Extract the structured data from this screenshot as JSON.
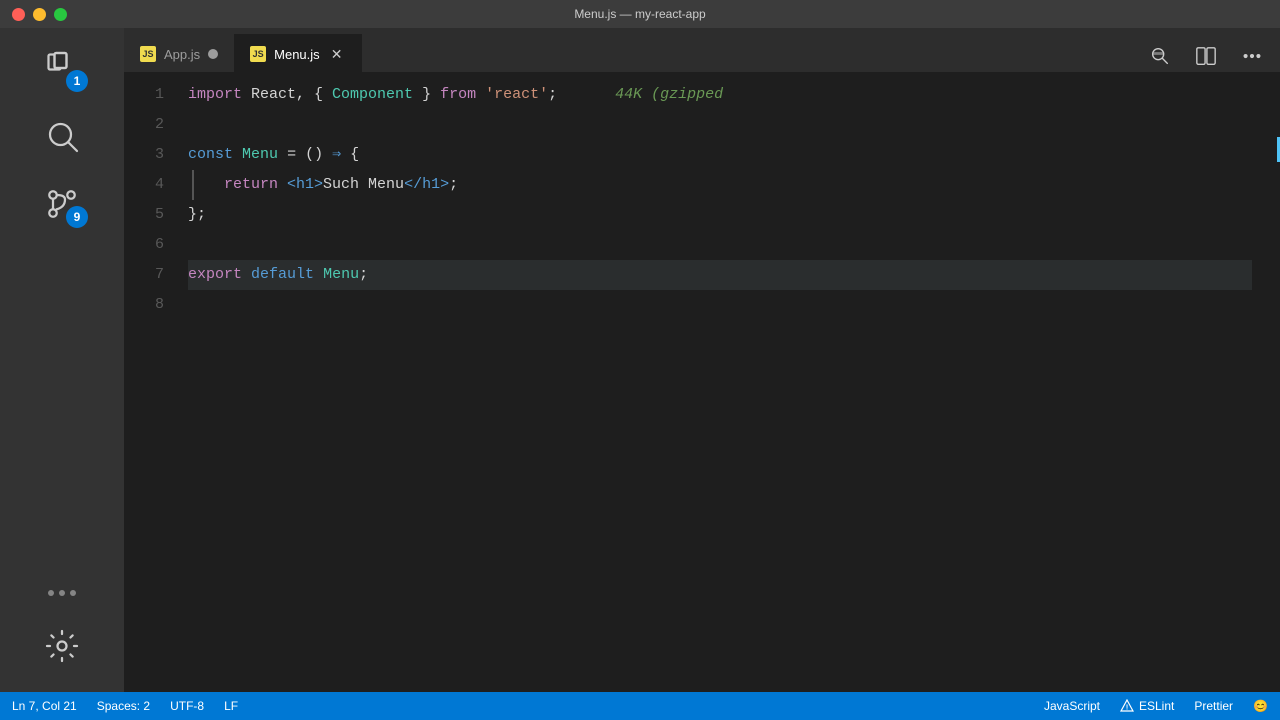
{
  "titleBar": {
    "title": "Menu.js — my-react-app"
  },
  "tabs": [
    {
      "id": "app-js",
      "label": "App.js",
      "active": false,
      "modified": true
    },
    {
      "id": "menu-js",
      "label": "Menu.js",
      "active": true,
      "modified": false
    }
  ],
  "toolbar": {
    "search_icon_label": "search",
    "split_icon_label": "split-editor",
    "more_icon_label": "more-actions"
  },
  "code": {
    "lines": [
      {
        "num": 1,
        "tokens": [
          {
            "type": "kw-import",
            "text": "import"
          },
          {
            "type": "plain",
            "text": " React, "
          },
          {
            "type": "punct",
            "text": "{ "
          },
          {
            "type": "comp",
            "text": "Component"
          },
          {
            "type": "punct",
            "text": " }"
          },
          {
            "type": "plain",
            "text": " "
          },
          {
            "type": "kw-from",
            "text": "from"
          },
          {
            "type": "plain",
            "text": " "
          },
          {
            "type": "str",
            "text": "'react'"
          },
          {
            "type": "plain",
            "text": ";"
          },
          {
            "type": "hint",
            "text": "  44K (gzipped"
          }
        ],
        "highlighted": false
      },
      {
        "num": 2,
        "tokens": [],
        "highlighted": false
      },
      {
        "num": 3,
        "tokens": [
          {
            "type": "kw-const",
            "text": "const"
          },
          {
            "type": "plain",
            "text": " "
          },
          {
            "type": "comp",
            "text": "Menu"
          },
          {
            "type": "plain",
            "text": " "
          },
          {
            "type": "punct",
            "text": "="
          },
          {
            "type": "plain",
            "text": " "
          },
          {
            "type": "punct",
            "text": "()"
          },
          {
            "type": "plain",
            "text": " "
          },
          {
            "type": "arrow",
            "text": "⇒"
          },
          {
            "type": "plain",
            "text": " "
          },
          {
            "type": "punct",
            "text": "{"
          }
        ],
        "highlighted": false
      },
      {
        "num": 4,
        "tokens": [
          {
            "type": "kw-return",
            "text": "return"
          },
          {
            "type": "plain",
            "text": " "
          },
          {
            "type": "tag",
            "text": "<h1>"
          },
          {
            "type": "plain",
            "text": "Such Menu"
          },
          {
            "type": "tag-close",
            "text": "</h1>"
          },
          {
            "type": "plain",
            "text": ";"
          }
        ],
        "highlighted": false,
        "indent": "block"
      },
      {
        "num": 5,
        "tokens": [
          {
            "type": "punct",
            "text": "};"
          }
        ],
        "highlighted": false
      },
      {
        "num": 6,
        "tokens": [],
        "highlighted": false
      },
      {
        "num": 7,
        "tokens": [
          {
            "type": "kw-export",
            "text": "export"
          },
          {
            "type": "plain",
            "text": " "
          },
          {
            "type": "kw-default",
            "text": "default"
          },
          {
            "type": "plain",
            "text": " "
          },
          {
            "type": "comp",
            "text": "Menu"
          },
          {
            "type": "plain",
            "text": ";"
          }
        ],
        "highlighted": true
      },
      {
        "num": 8,
        "tokens": [],
        "highlighted": false
      }
    ]
  },
  "statusBar": {
    "position": "Ln 7, Col 21",
    "spaces": "Spaces: 2",
    "encoding": "UTF-8",
    "eol": "LF",
    "language": "JavaScript",
    "eslint": "ESLint",
    "prettier": "Prettier",
    "smiley": "😊"
  },
  "activityBar": {
    "items": [
      {
        "id": "explorer",
        "badge": "1"
      },
      {
        "id": "search",
        "badge": null
      },
      {
        "id": "source-control",
        "badge": "9"
      },
      {
        "id": "extensions",
        "badge": null
      }
    ]
  }
}
